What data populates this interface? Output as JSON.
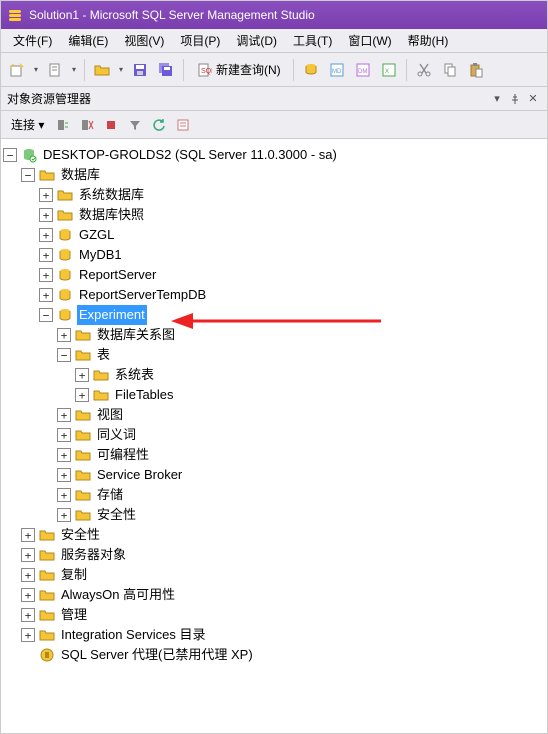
{
  "title": "Solution1 - Microsoft SQL Server Management Studio",
  "menu": {
    "file": "文件(F)",
    "edit": "编辑(E)",
    "view": "视图(V)",
    "project": "项目(P)",
    "debug": "调试(D)",
    "tools": "工具(T)",
    "window": "窗口(W)",
    "help": "帮助(H)"
  },
  "toolbar": {
    "new_query": "新建查询(N)"
  },
  "panel": {
    "title": "对象资源管理器",
    "connect": "连接 ▾"
  },
  "tree": {
    "server": "DESKTOP-GROLDS2 (SQL Server 11.0.3000 - sa)",
    "databases": "数据库",
    "sysdb": "系统数据库",
    "snapshots": "数据库快照",
    "db_gzgl": "GZGL",
    "db_mydb1": "MyDB1",
    "db_rs": "ReportServer",
    "db_rstmp": "ReportServerTempDB",
    "db_exp": "Experiment",
    "db_diag": "数据库关系图",
    "tables": "表",
    "systables": "系统表",
    "filetables": "FileTables",
    "views": "视图",
    "synonyms": "同义词",
    "prog": "可编程性",
    "sb": "Service Broker",
    "storage": "存储",
    "sec_db": "安全性",
    "security": "安全性",
    "serverobj": "服务器对象",
    "replication": "复制",
    "alwayson": "AlwaysOn 高可用性",
    "mgmt": "管理",
    "is_cat": "Integration Services 目录",
    "agent": "SQL Server 代理(已禁用代理 XP)"
  }
}
